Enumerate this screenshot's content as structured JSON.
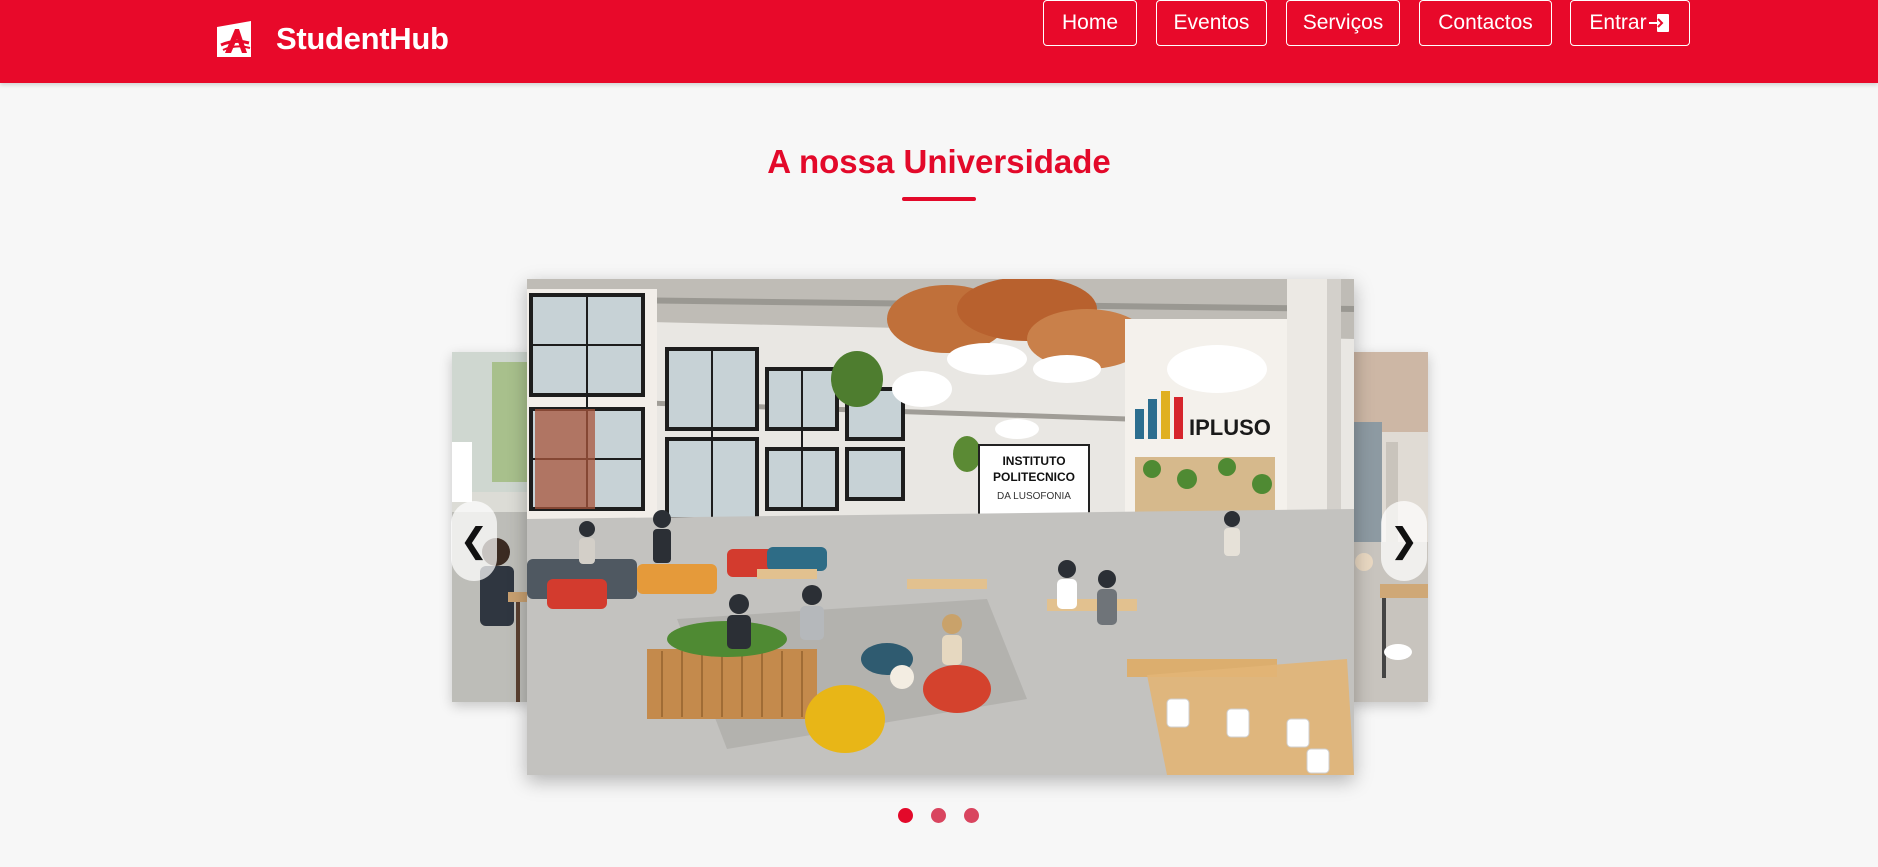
{
  "header": {
    "brand_name": "StudentHub",
    "logo_icon": "student-hub-logo-icon",
    "background_color": "#e8092a"
  },
  "nav": {
    "items": [
      {
        "label": "Home"
      },
      {
        "label": "Eventos"
      },
      {
        "label": "Serviços"
      },
      {
        "label": "Contactos"
      },
      {
        "label": "Entrar"
      }
    ],
    "login_icon": "login-arrow-icon"
  },
  "section": {
    "title": "A nossa Universidade",
    "accent_color": "#e3092a"
  },
  "carousel": {
    "prev_label": "❮",
    "next_label": "❯",
    "slides": [
      {
        "sign_line_1": "INSTITUTO",
        "sign_line_2": "POLITECNICO",
        "sign_line_3": "DA LUSOFONIA",
        "wall_logo_text": "IPLUSO"
      }
    ],
    "dots": [
      {
        "active": true,
        "color": "#e3092a"
      },
      {
        "active": false,
        "color": "#d9455f"
      },
      {
        "active": false,
        "color": "#d9455f"
      }
    ]
  }
}
